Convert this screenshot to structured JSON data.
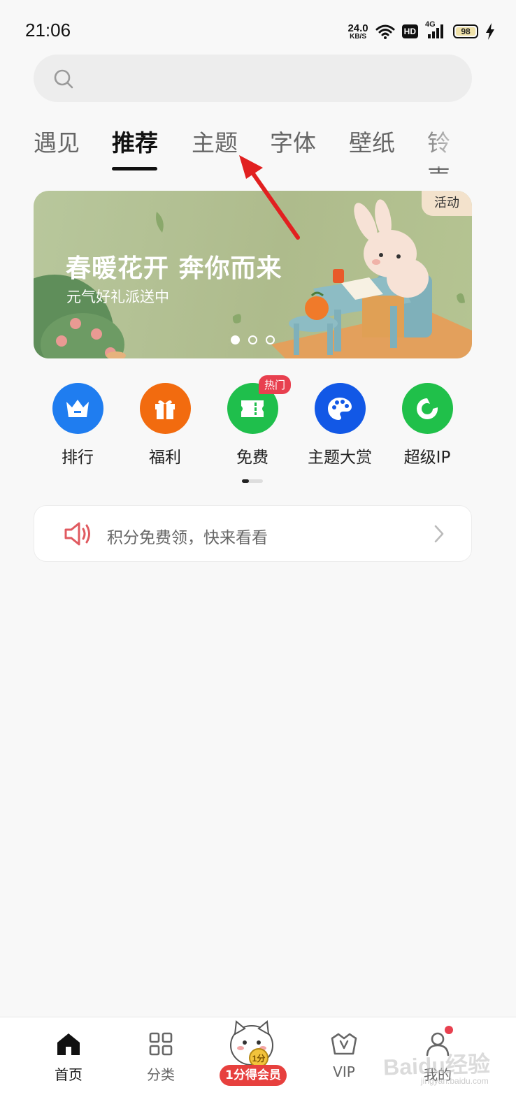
{
  "status_bar": {
    "time": "21:06",
    "net_speed_value": "24.0",
    "net_speed_unit": "KB/S",
    "hd_label": "HD",
    "network_label": "4G",
    "battery_level": "98"
  },
  "search": {
    "placeholder": ""
  },
  "tabs": [
    {
      "label": "遇见"
    },
    {
      "label": "推荐",
      "active": true
    },
    {
      "label": "主题"
    },
    {
      "label": "字体"
    },
    {
      "label": "壁纸"
    },
    {
      "label": "铃声"
    }
  ],
  "banner": {
    "title": "春暖花开 奔你而来",
    "subtitle": "元气好礼派送中",
    "tag": "活动",
    "slide_count": 3,
    "active_slide": 1
  },
  "quick_entries": [
    {
      "label": "排行",
      "icon": "crown-icon",
      "color": "#1f7df0"
    },
    {
      "label": "福利",
      "icon": "gift-icon",
      "color": "#f26b0f"
    },
    {
      "label": "免费",
      "icon": "ticket-icon",
      "color": "#1fbf4c",
      "badge": "热门"
    },
    {
      "label": "主题大赏",
      "icon": "palette-icon",
      "color": "#1258e6"
    },
    {
      "label": "超级IP",
      "icon": "play-icon",
      "color": "#20c04a"
    }
  ],
  "notice": {
    "text": "积分免费领，快来看看"
  },
  "bottom_nav": [
    {
      "label": "首页",
      "icon": "home-icon",
      "active": true
    },
    {
      "label": "分类",
      "icon": "grid-icon"
    },
    {
      "label": "1分得会员",
      "icon": "cat-mascot-icon"
    },
    {
      "label": "VIP",
      "icon": "vip-crown-icon"
    },
    {
      "label": "我的",
      "icon": "user-icon",
      "has_dot": true
    }
  ],
  "watermark": {
    "brand": "Baidu经验",
    "url": "jingyan.baidu.com"
  }
}
